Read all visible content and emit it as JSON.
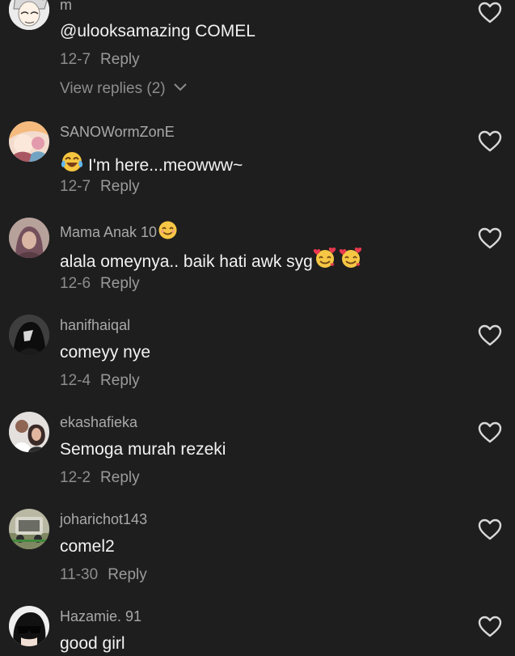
{
  "comments": [
    {
      "username": "m",
      "text": "@ulooksamazing COMEL",
      "date": "12-7",
      "reply_label": "Reply",
      "avatar_icon": "manga-avatar"
    },
    {
      "username": "SANOWormZonE",
      "text": "I'm here...meowww~",
      "text_emoji": "joy-tears-emoji",
      "date": "12-7",
      "reply_label": "Reply",
      "avatar_icon": "anime-avatar"
    },
    {
      "username": "Mama Anak 10",
      "username_emoji": "smiling-emoji",
      "text": "alala omeynya.. baik hati awk syg",
      "text_emoji": "smiling-face-with-hearts-emoji",
      "date": "12-6",
      "reply_label": "Reply",
      "avatar_icon": "photo-avatar"
    },
    {
      "username": "hanifhaiqal",
      "text": "comeyy nye",
      "date": "12-4",
      "reply_label": "Reply",
      "avatar_icon": "dark-figure-avatar"
    },
    {
      "username": "ekashafieka",
      "text": "Semoga murah rezeki",
      "date": "12-2",
      "reply_label": "Reply",
      "avatar_icon": "couple-photo-avatar"
    },
    {
      "username": "joharichot143",
      "text": "comel2",
      "date": "11-30",
      "reply_label": "Reply",
      "avatar_icon": "vehicle-photo-avatar"
    },
    {
      "username": "Hazamie. 91",
      "text": "good girl",
      "avatar_icon": "sunglasses-avatar"
    }
  ],
  "view_replies": {
    "label": "View replies (2)"
  },
  "colors": {
    "background": "#1e1e1e",
    "text": "#f2f2f2",
    "muted": "#8d8d8d",
    "heart": "#d8d8d8"
  }
}
